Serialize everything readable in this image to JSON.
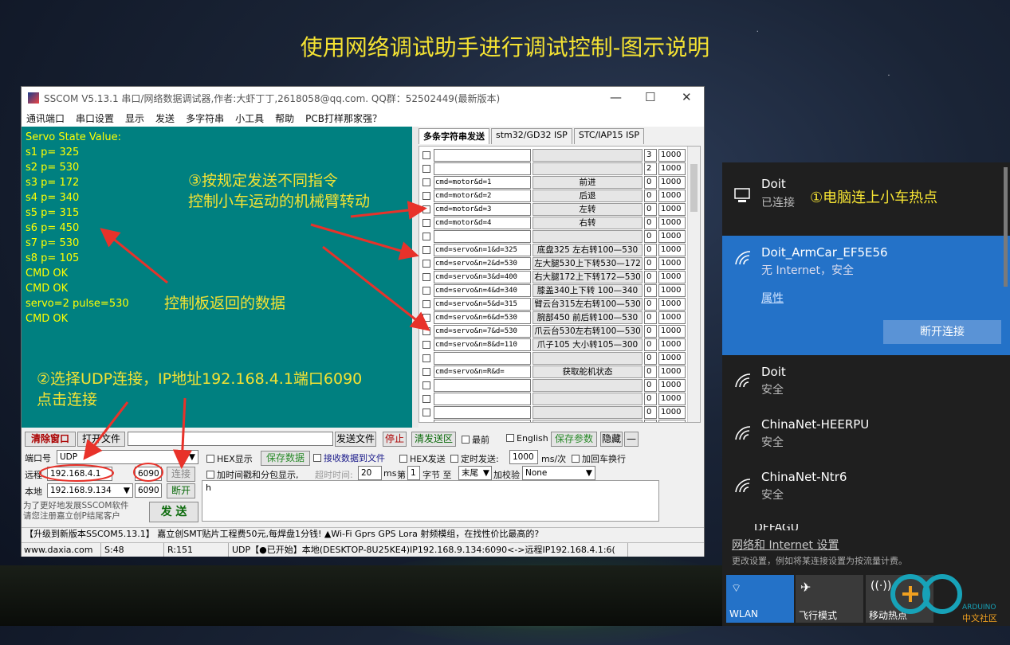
{
  "headline": "使用网络调试助手进行调试控制-图示说明",
  "window": {
    "title": "SSCOM V5.13.1 串口/网络数据调试器,作者:大虾丁丁,2618058@qq.com. QQ群：52502449(最新版本)",
    "minimize": "—",
    "maximize": "☐",
    "close": "✕"
  },
  "menu": [
    "通讯端口",
    "串口设置",
    "显示",
    "发送",
    "多字符串",
    "小工具",
    "帮助",
    "PCB打样那家强？"
  ],
  "receive_lines": [
    "Servo State Value:",
    "s1 p= 325",
    "s2 p= 530",
    "s3 p= 172",
    "s4 p= 340",
    "s5 p= 315",
    "s6 p= 450",
    "s7 p= 530",
    "s8 p= 105",
    "CMD OK",
    "CMD OK",
    "servo=2 pulse=530",
    "CMD OK"
  ],
  "tabs": [
    "多条字符串发送",
    "stm32/GD32 ISP",
    "STC/IAP15 ISP"
  ],
  "multi_rows": [
    {
      "cmd": "",
      "desc": "",
      "num": "3",
      "ms": "1000"
    },
    {
      "cmd": "",
      "desc": "",
      "num": "2",
      "ms": "1000"
    },
    {
      "cmd": "cmd=motor&d=1",
      "desc": "前进",
      "num": "0",
      "ms": "1000"
    },
    {
      "cmd": "cmd=motor&d=2",
      "desc": "后退",
      "num": "0",
      "ms": "1000"
    },
    {
      "cmd": "cmd=motor&d=3",
      "desc": "左转",
      "num": "0",
      "ms": "1000"
    },
    {
      "cmd": "cmd=motor&d=4",
      "desc": "右转",
      "num": "0",
      "ms": "1000"
    },
    {
      "cmd": "",
      "desc": "",
      "num": "0",
      "ms": "1000"
    },
    {
      "cmd": "cmd=servo&n=1&d=325",
      "desc": "底盘325 左右转100—530",
      "num": "0",
      "ms": "1000"
    },
    {
      "cmd": "cmd=servo&n=2&d=530",
      "desc": "左大腿530上下转530—172",
      "num": "0",
      "ms": "1000"
    },
    {
      "cmd": "cmd=servo&n=3&d=400",
      "desc": "右大腿172上下转172—530",
      "num": "0",
      "ms": "1000"
    },
    {
      "cmd": "cmd=servo&n=4&d=340",
      "desc": "膝盖340上下转 100—340",
      "num": "0",
      "ms": "1000"
    },
    {
      "cmd": "cmd=servo&n=5&d=315",
      "desc": "臂云台315左右转100—530",
      "num": "0",
      "ms": "1000"
    },
    {
      "cmd": "cmd=servo&n=6&d=530",
      "desc": "腕部450 前后转100—530",
      "num": "0",
      "ms": "1000"
    },
    {
      "cmd": "cmd=servo&n=7&d=530",
      "desc": "爪云台530左右转100—530",
      "num": "0",
      "ms": "1000"
    },
    {
      "cmd": "cmd=servo&n=8&d=110",
      "desc": "爪子105 大小转105—300",
      "num": "0",
      "ms": "1000"
    },
    {
      "cmd": "",
      "desc": "",
      "num": "0",
      "ms": "1000"
    },
    {
      "cmd": "cmd=servo&n=R&d=",
      "desc": "获取舵机状态",
      "num": "0",
      "ms": "1000"
    },
    {
      "cmd": "",
      "desc": "",
      "num": "0",
      "ms": "1000"
    },
    {
      "cmd": "",
      "desc": "",
      "num": "0",
      "ms": "1000"
    },
    {
      "cmd": "",
      "desc": "",
      "num": "0",
      "ms": "1000"
    },
    {
      "cmd": "",
      "desc": "",
      "num": "0",
      "ms": "1000"
    }
  ],
  "toolbar": {
    "clear": "清除窗口",
    "open_file": "打开文件",
    "send_file": "发送文件",
    "stop": "停止",
    "clear_send": "清发送区",
    "topmost": "最前",
    "english": "English",
    "save_params": "保存参数",
    "hide": "隐藏",
    "minus": "—"
  },
  "conn": {
    "port_label": "端口号",
    "port_value": "UDP",
    "remote_label": "远程",
    "remote_ip": "192.168.4.1",
    "remote_port": "6090",
    "connect": "连接",
    "local_label": "本地",
    "local_ip": "192.168.9.134",
    "local_port": "6090",
    "disconnect": "断开",
    "promo": "为了更好地发展SSCOM软件\n请您注册嘉立创P结尾客户",
    "send": "发 送"
  },
  "options": {
    "hex_display": "HEX显示",
    "save_data": "保存数据",
    "recv_to_file": "接收数据到文件",
    "hex_send": "HEX发送",
    "timed_send": "定时发送:",
    "interval": "1000",
    "interval_unit": "ms/次",
    "add_crlf": "加回车换行",
    "add_timestamp": "加时间戳和分包显示,",
    "timeout_label": "超时时间:",
    "timeout": "20",
    "ms": "ms",
    "nth_label": "第",
    "nth": "1",
    "byte_to": "字节 至",
    "tail": "末尾",
    "checksum_label": "加校验",
    "checksum": "None"
  },
  "send_text": "h",
  "status_ad": "【升级到新版本SSCOM5.13.1】      嘉立创SMT贴片工程费50元,每焊盘1分钱! ▲Wi-Fi Gprs GPS Lora 射频模组，在找性价比最高的?",
  "statusbar": {
    "site": "www.daxia.com",
    "sent": "S:48",
    "recv": "R:151",
    "info": "UDP【●已开始】本地(DESKTOP-8U25KE4)IP192.168.9.134:6090<->远程IP192.168.4.1:6("
  },
  "annotations": {
    "step1": "①电脑连上小车热点",
    "step2_line1": "②选择UDP连接，IP地址192.168.4.1端口6090",
    "step2_line2": "点击连接",
    "step3_line1": "③按规定发送不同指令",
    "step3_line2": "控制小车运动的机械臂转动",
    "returned": "控制板返回的数据"
  },
  "wifi": {
    "current": {
      "name": "Doit",
      "status": "已连接"
    },
    "selected": {
      "name": "Doit_ArmCar_EF5E56",
      "status": "无 Internet，安全",
      "properties": "属性",
      "disconnect": "断开连接"
    },
    "others": [
      {
        "name": "Doit",
        "status": "安全"
      },
      {
        "name": "ChinaNet-HEERPU",
        "status": "安全"
      },
      {
        "name": "ChinaNet-Ntr6",
        "status": "安全"
      }
    ],
    "partial": "DFFAGU",
    "settings_title": "网络和 Internet 设置",
    "settings_sub": "更改设置，例如将某连接设置为按流量计费。",
    "quick": [
      {
        "label": "WLAN"
      },
      {
        "label": "飞行模式"
      },
      {
        "label": "移动热点"
      }
    ]
  },
  "watermark": {
    "line1": "ARDUINO",
    "line2": "中文社区"
  },
  "colors": {
    "receive_bg": "#008080",
    "receive_text": "#ffff00",
    "annotation": "#f4e233",
    "wifi_selected": "#2472c8",
    "arrow": "#e8322a"
  }
}
